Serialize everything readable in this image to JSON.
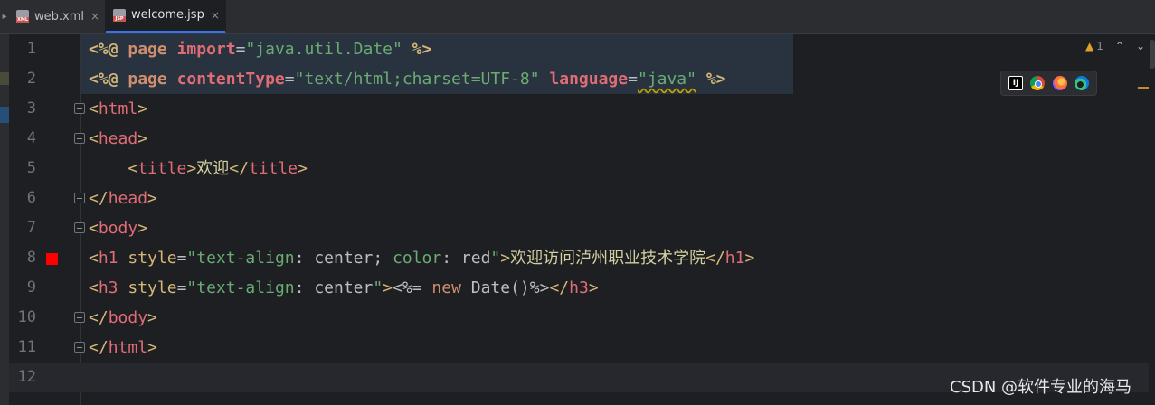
{
  "tabs": [
    {
      "label": "web.xml",
      "badge": "XML",
      "close": "×",
      "active": false
    },
    {
      "label": "welcome.jsp",
      "badge": "JSP",
      "close": "×",
      "active": true
    }
  ],
  "tab_overflow_glyph": "▸",
  "line_numbers": [
    "1",
    "2",
    "3",
    "4",
    "5",
    "6",
    "7",
    "8",
    "9",
    "10",
    "11",
    "12"
  ],
  "code": {
    "l1": {
      "open": "<%@ ",
      "dir": "page",
      "sp1": " ",
      "attr": "import",
      "eq": "=",
      "val": "\"java.util.Date\"",
      "close": " %>"
    },
    "l2": {
      "open": "<%@ ",
      "dir": "page",
      "sp1": " ",
      "attr1": "contentType",
      "eq1": "=",
      "val1": "\"text/html;charset=UTF-8\"",
      "sp2": " ",
      "attr2": "language",
      "eq2": "=",
      "val2": "\"java\"",
      "close": " %>"
    },
    "l3": {
      "lt": "<",
      "tag": "html",
      "gt": ">"
    },
    "l4": {
      "lt": "<",
      "tag": "head",
      "gt": ">"
    },
    "l5": {
      "indent": "    ",
      "lt": "<",
      "tag": "title",
      "gt": ">",
      "text": "欢迎",
      "lt2": "</",
      "tag2": "title",
      "gt2": ">"
    },
    "l6": {
      "lt": "</",
      "tag": "head",
      "gt": ">"
    },
    "l7": {
      "lt": "<",
      "tag": "body",
      "gt": ">"
    },
    "l8": {
      "lt": "<",
      "tag": "h1",
      "sp": " ",
      "attr": "style",
      "eq": "=",
      "q1": "\"",
      "p1": "text-align",
      "c1": ": ",
      "v1": "center",
      "s1": "; ",
      "p2": "color",
      "c2": ": ",
      "v2": "red",
      "q2": "\"",
      "gt": ">",
      "text": "欢迎访问泸州职业技术学院",
      "lt2": "</",
      "tag2": "h1",
      "gt2": ">"
    },
    "l9": {
      "lt": "<",
      "tag": "h3",
      "sp": " ",
      "attr": "style",
      "eq": "=",
      "q1": "\"",
      "p1": "text-align",
      "c1": ": ",
      "v1": "center",
      "q2": "\"",
      "gt": ">",
      "expr_open": "<%= ",
      "kw": "new",
      "sp2": " ",
      "cls": "Date()",
      "expr_close": "%>",
      "lt2": "</",
      "tag2": "h3",
      "gt2": ">"
    },
    "l10": {
      "lt": "</",
      "tag": "body",
      "gt": ">"
    },
    "l11": {
      "lt": "</",
      "tag": "html",
      "gt": ">"
    }
  },
  "inspections": {
    "warning_icon": "warning-triangle",
    "warning_glyph": "▲",
    "count": "1",
    "up": "⌃",
    "down": "⌄"
  },
  "browser_icons": [
    "intellij-icon",
    "chrome-icon",
    "firefox-icon",
    "edge-icon"
  ],
  "ij_label": "IJ",
  "watermark": "CSDN @软件专业的海马",
  "colors": {
    "breakpoint": "#ff0000",
    "tab_accent": "#3574f0"
  }
}
